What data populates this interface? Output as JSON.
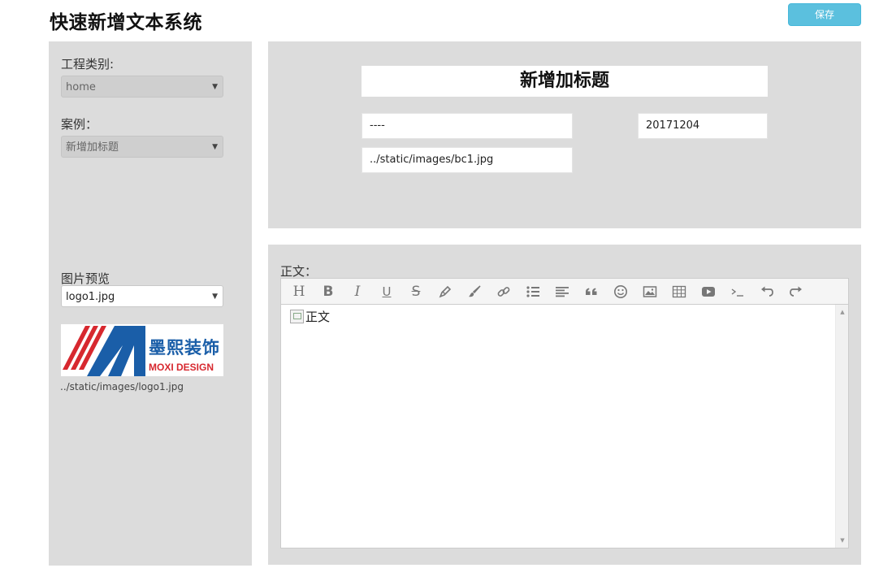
{
  "header": {
    "title": "快速新增文本系统",
    "save_label": "保存"
  },
  "sidebar": {
    "project_type_label": "工程类别:",
    "project_type_value": "home",
    "case_label": "案例：",
    "case_value": "新增加标题",
    "image_preview_label": "图片预览",
    "image_select_value": "logo1.jpg",
    "logo": {
      "brand_cn": "墨熙装饰",
      "brand_en": "MOXI DESIGN"
    },
    "image_path": "../static/images/logo1.jpg"
  },
  "form": {
    "title_value": "新增加标题",
    "author_value": "----",
    "date_value": "20171204",
    "image_path_value": "../static/images/bc1.jpg"
  },
  "body_editor": {
    "label": "正文：",
    "content_text": "正文",
    "toolbar_icons": [
      "heading-icon",
      "bold-icon",
      "italic-icon",
      "underline-icon",
      "strikethrough-icon",
      "highlighter-icon",
      "brush-icon",
      "link-icon",
      "unordered-list-icon",
      "align-left-icon",
      "quote-icon",
      "emoji-icon",
      "image-icon",
      "table-icon",
      "video-icon",
      "code-icon",
      "undo-icon",
      "redo-icon"
    ]
  },
  "colors": {
    "save_button": "#5bc0de",
    "panel_bg": "#dcdcdc",
    "logo_blue": "#1a5ea8",
    "logo_red": "#d7282f"
  }
}
